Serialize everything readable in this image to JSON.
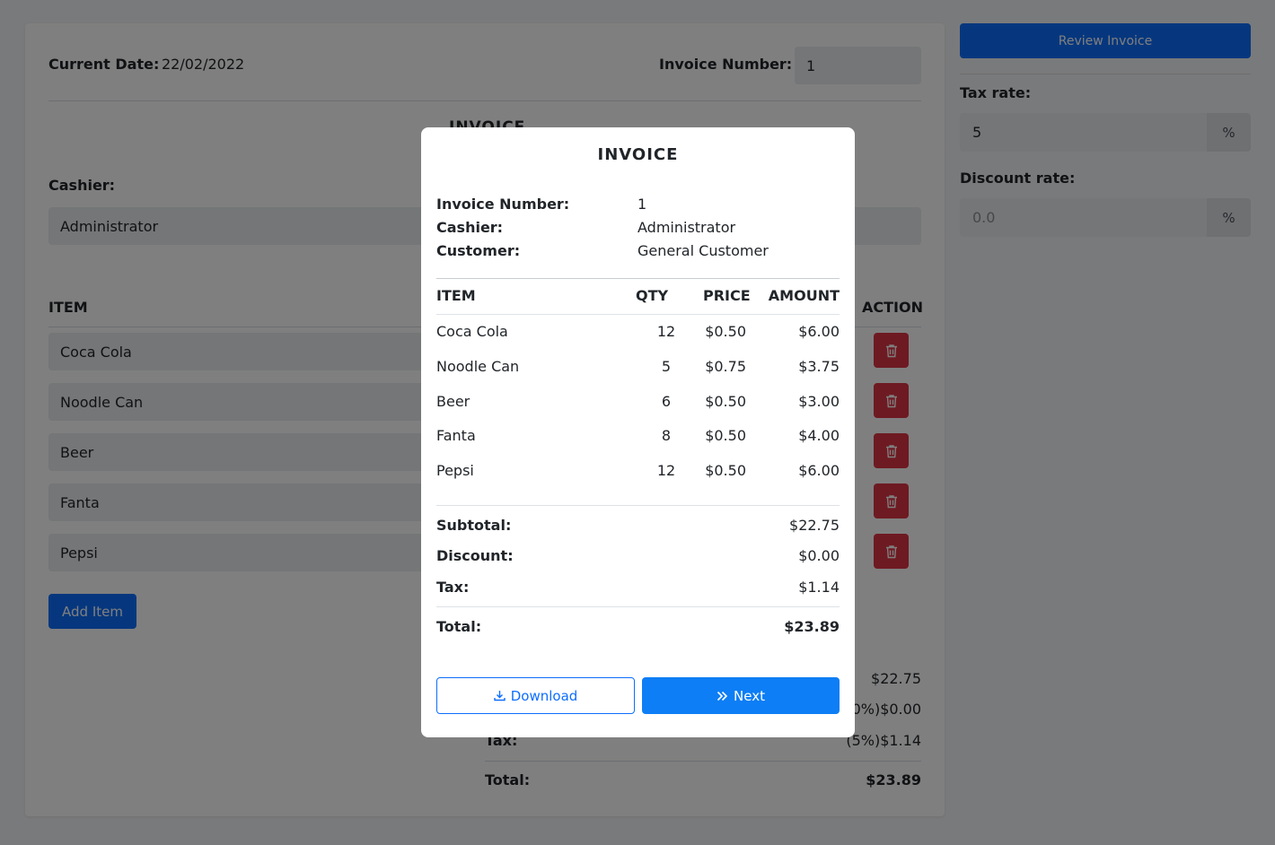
{
  "form": {
    "current_date_label": "Current Date:",
    "current_date_value": "22/02/2022",
    "invoice_number_label": "Invoice Number:",
    "invoice_number_value": "1",
    "invoice_heading": "INVOICE",
    "cashier_label": "Cashier:",
    "cashier_value": "Administrator",
    "item_header": "ITEM",
    "action_header": "ACTION",
    "items": [
      "Coca Cola",
      "Noodle Can",
      "Beer",
      "Fanta",
      "Pepsi"
    ],
    "add_item_label": "Add Item",
    "totals": {
      "subtotal_value": "$22.75",
      "discount_value": "0%)$0.00",
      "tax_label": "Tax:",
      "tax_value": "(5%)$1.14",
      "total_label": "Total:",
      "total_value": "$23.89"
    }
  },
  "sidebar": {
    "review_label": "Review Invoice",
    "tax_rate_label": "Tax rate:",
    "tax_rate_value": "5",
    "tax_rate_suffix": "%",
    "discount_rate_label": "Discount rate:",
    "discount_rate_placeholder": "0.0",
    "discount_rate_suffix": "%"
  },
  "modal": {
    "title": "INVOICE",
    "invoice_number_label": "Invoice Number:",
    "invoice_number_value": "1",
    "cashier_label": "Cashier:",
    "cashier_value": "Administrator",
    "customer_label": "Customer:",
    "customer_value": "General Customer",
    "columns": {
      "item": "ITEM",
      "qty": "QTY",
      "price": "PRICE",
      "amount": "AMOUNT"
    },
    "rows": [
      {
        "item": "Coca Cola",
        "qty": "12",
        "price": "$0.50",
        "amount": "$6.00"
      },
      {
        "item": "Noodle Can",
        "qty": "5",
        "price": "$0.75",
        "amount": "$3.75"
      },
      {
        "item": "Beer",
        "qty": "6",
        "price": "$0.50",
        "amount": "$3.00"
      },
      {
        "item": "Fanta",
        "qty": "8",
        "price": "$0.50",
        "amount": "$4.00"
      },
      {
        "item": "Pepsi",
        "qty": "12",
        "price": "$0.50",
        "amount": "$6.00"
      }
    ],
    "subtotal_label": "Subtotal:",
    "subtotal_value": "$22.75",
    "discount_label": "Discount:",
    "discount_value": "$0.00",
    "tax_label": "Tax:",
    "tax_value": "$1.14",
    "total_label": "Total:",
    "total_value": "$23.89",
    "download_label": "Download",
    "next_label": "Next"
  },
  "colors": {
    "primary": "#0d6efd",
    "danger": "#dc3545",
    "overlay": "rgba(0,0,0,0.5)"
  },
  "icons": [
    "trash-icon",
    "download-icon",
    "double-chevron-right-icon"
  ]
}
